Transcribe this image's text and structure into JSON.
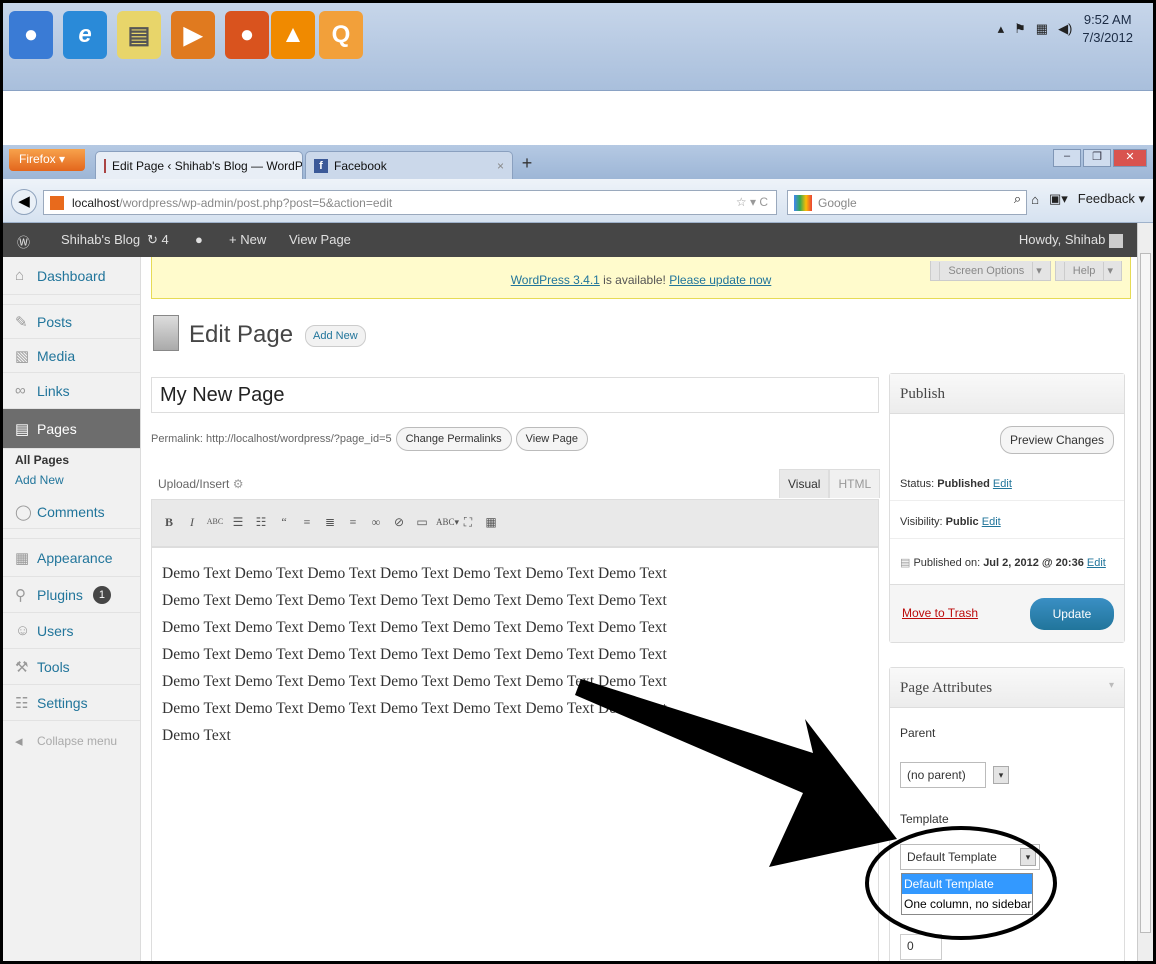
{
  "taskbar": {
    "apps": [
      {
        "name": "chrome-icon",
        "color": "#3a7bd5",
        "glyph": "●"
      },
      {
        "name": "internet-explorer-icon",
        "color": "#2a8ad8",
        "glyph": "e"
      },
      {
        "name": "notepad-icon",
        "color": "#e8d56a",
        "glyph": "▤"
      },
      {
        "name": "media-player-icon",
        "color": "#e07a1f",
        "glyph": "▶"
      },
      {
        "name": "firefox-icon",
        "color": "#d9531e",
        "glyph": "●"
      },
      {
        "name": "vlc-icon",
        "color": "#f08a00",
        "glyph": "▲"
      },
      {
        "name": "quicktime-icon",
        "color": "#f2a03a",
        "glyph": "Q"
      }
    ],
    "time": "9:52 AM",
    "date": "7/3/2012"
  },
  "browser": {
    "menu_label": "Firefox",
    "tabs": [
      {
        "label": "Edit Page ‹ Shihab's Blog — WordPress"
      },
      {
        "label": "Facebook"
      }
    ],
    "url_host": "localhost",
    "url_path": "/wordpress/wp-admin/post.php?post=5&action=edit",
    "search_placeholder": "Google",
    "feedback_label": "Feedback"
  },
  "adminbar": {
    "site_name": "Shihab's Blog",
    "updates_count": "4",
    "new_label": "New",
    "view_page_label": "View Page",
    "howdy": "Howdy, Shihab"
  },
  "sidebar": {
    "dashboard": "Dashboard",
    "posts": "Posts",
    "media": "Media",
    "links": "Links",
    "pages": "Pages",
    "all_pages": "All Pages",
    "add_new": "Add New",
    "comments": "Comments",
    "appearance": "Appearance",
    "plugins": "Plugins",
    "plugins_badge": "1",
    "users": "Users",
    "tools": "Tools",
    "settings": "Settings",
    "collapse": "Collapse menu"
  },
  "notice": {
    "version_link": "WordPress 3.4.1",
    "middle": " is available! ",
    "update_link": "Please update now",
    "screen_options": "Screen Options",
    "help": "Help"
  },
  "editor": {
    "heading": "Edit Page",
    "add_new": "Add New",
    "title_value": "My New Page",
    "permalink_text": "Permalink: http://localhost/wordpress/?page_id=5",
    "change_permalinks": "Change Permalinks",
    "view_page": "View Page",
    "upload_insert": "Upload/Insert",
    "tab_visual": "Visual",
    "tab_html": "HTML",
    "body_text": "Demo Text Demo Text Demo Text Demo Text Demo Text Demo Text Demo Text Demo Text Demo Text Demo Text Demo Text Demo Text Demo Text Demo Text Demo Text Demo Text Demo Text Demo Text Demo Text Demo Text Demo Text Demo Text Demo Text Demo Text Demo Text Demo Text Demo Text Demo Text Demo Text Demo Text Demo Text Demo Text Demo Text Demo Text Demo Text Demo Text Demo Text Demo Text Demo Text Demo Text Demo Text Demo Text Demo Text"
  },
  "publish": {
    "title": "Publish",
    "preview_changes": "Preview Changes",
    "status_label": "Status: ",
    "status_value": "Published",
    "visibility_label": "Visibility: ",
    "visibility_value": "Public",
    "published_label": "Published on: ",
    "published_value": "Jul 2, 2012 @ 20:36",
    "edit": "Edit",
    "move_to_trash": "Move to Trash",
    "update": "Update"
  },
  "attributes": {
    "title": "Page Attributes",
    "parent_label": "Parent",
    "parent_value": "(no parent)",
    "template_label": "Template",
    "template_value": "Default Template",
    "template_options": [
      "Default Template",
      "One column, no sidebar"
    ],
    "order_value": "0"
  }
}
